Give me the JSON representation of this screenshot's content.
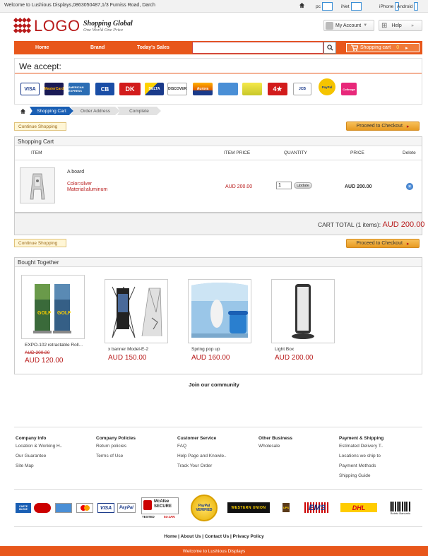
{
  "topbar": {
    "welcome": "Welcome to Lushious Displays,0863050487,1/3 Furniss Road, Darch",
    "devices": [
      "pc",
      "iNet",
      "iPhone",
      "Android"
    ]
  },
  "header": {
    "logo": "LOGO",
    "slogan_main": "Shopping Global",
    "slogan_sub": "One World One Price",
    "account": "My Account",
    "help": "Help"
  },
  "nav": {
    "items": [
      "Home",
      "Brand",
      "Today's Sales"
    ],
    "search_placeholder": "",
    "cart": "Shopping cart",
    "cart_count": "0"
  },
  "accept": {
    "title": "We accept:",
    "cards": [
      "VISA",
      "MasterCard",
      "AMERICAN EXPRESS",
      "CB",
      "DK",
      "DELTA",
      "DISCOVER",
      "Aurora",
      "",
      "",
      "4★",
      "JCB",
      "PayPal",
      "Cofinoga"
    ]
  },
  "steps": [
    "Shopping Cart",
    "Order Address",
    "Complete"
  ],
  "buttons": {
    "continue": "Continue Shopping",
    "checkout": "Proceed to Checkout"
  },
  "cart": {
    "title": "Shopping Cart",
    "columns": [
      "ITEM",
      "ITEM PRICE",
      "QUANTITY",
      "PRICE",
      "Delete"
    ],
    "item": {
      "name": "A board",
      "color": "Color:silver",
      "material": "Material:aluminum",
      "item_price": "AUD 200.00",
      "quantity": "1",
      "update": "Update",
      "price": "AUD 200.00"
    },
    "total_label": "CART TOTAL (1 items):",
    "total_value": "AUD 200.00"
  },
  "bought_together": {
    "title": "Bought Together",
    "items": [
      {
        "name": "EXPO-102 retractable Roll...",
        "old_price": "AUD 200.00",
        "price": "AUD 120.00"
      },
      {
        "name": "x banner Model-E-2",
        "old_price": "",
        "price": "AUD 150.00"
      },
      {
        "name": "Spring pop up",
        "old_price": "",
        "price": "AUD 160.00"
      },
      {
        "name": "Light Box",
        "old_price": "",
        "price": "AUD 200.00"
      }
    ]
  },
  "community": "Join our community",
  "footer": {
    "columns": [
      {
        "title": "Company Info",
        "items": [
          "Location & Working H..",
          "Our Guarantee",
          "Site Map"
        ]
      },
      {
        "title": "Company Policies",
        "items": [
          "Return policies",
          "Terms of Use"
        ]
      },
      {
        "title": "Customer Service",
        "items": [
          "FAQ",
          "Help Page and Knowle..",
          "Track Your Order"
        ]
      },
      {
        "title": "Other Business",
        "items": [
          "Wholesale"
        ]
      },
      {
        "title": "Payment & Shipping",
        "items": [
          "Estimated Delivery T..",
          "Locations we ship to",
          "Payment Methods",
          "Shipping Guide"
        ]
      }
    ],
    "logos": [
      "CARTE BLEUE",
      "",
      "",
      "",
      "VISA",
      "PayPal",
      "McAfee SECURE",
      "TESTED",
      "04-JAN",
      "PayPal VERIFIED",
      "WESTERN UNION",
      "UPS",
      "EMS",
      "DHL",
      "Boleto Bancario"
    ],
    "links": [
      "Home",
      "About Us",
      "Contact Us",
      "Privacy Policy"
    ],
    "bottom": "Welcome to Lushious Displays"
  }
}
